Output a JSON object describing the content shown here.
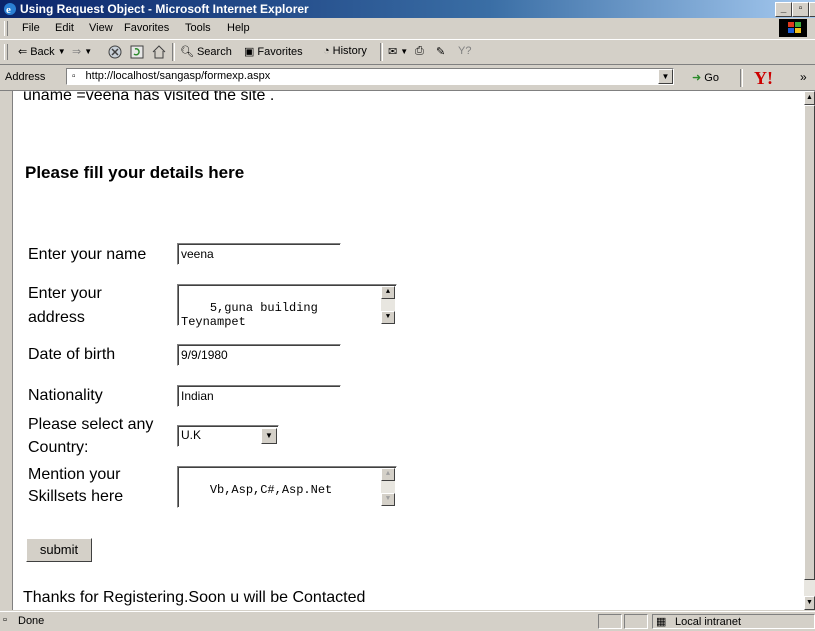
{
  "window": {
    "title": "Using Request Object - Microsoft Internet Explorer"
  },
  "menu": [
    "File",
    "Edit",
    "View",
    "Favorites",
    "Tools",
    "Help"
  ],
  "toolbar": {
    "back": "Back",
    "search": "Search",
    "favorites": "Favorites",
    "history": "History"
  },
  "address": {
    "label": "Address",
    "url": "http://localhost/sangasp/formexp.aspx",
    "go": "Go"
  },
  "page": {
    "visit_text": "uname =veena has visited the site .",
    "heading": "Please fill your details here",
    "name_label": "Enter your name",
    "name_value": "veena",
    "address_label_1": "Enter your",
    "address_label_2": "address",
    "address_value": "5,guna building\nTeynampet",
    "dob_label": "Date of birth",
    "dob_value": "9/9/1980",
    "nationality_label": "Nationality",
    "nationality_value": "Indian",
    "country_label_1": "Please select any",
    "country_label_2": "Country:",
    "country_value": "U.K",
    "skills_label_1": "Mention your",
    "skills_label_2": "Skillsets here",
    "skills_value": "Vb,Asp,C#,Asp.Net",
    "submit": "submit",
    "thanks": "Thanks for Registering.Soon u will be Contacted"
  },
  "status": {
    "text": "Done",
    "zone": "Local intranet"
  }
}
